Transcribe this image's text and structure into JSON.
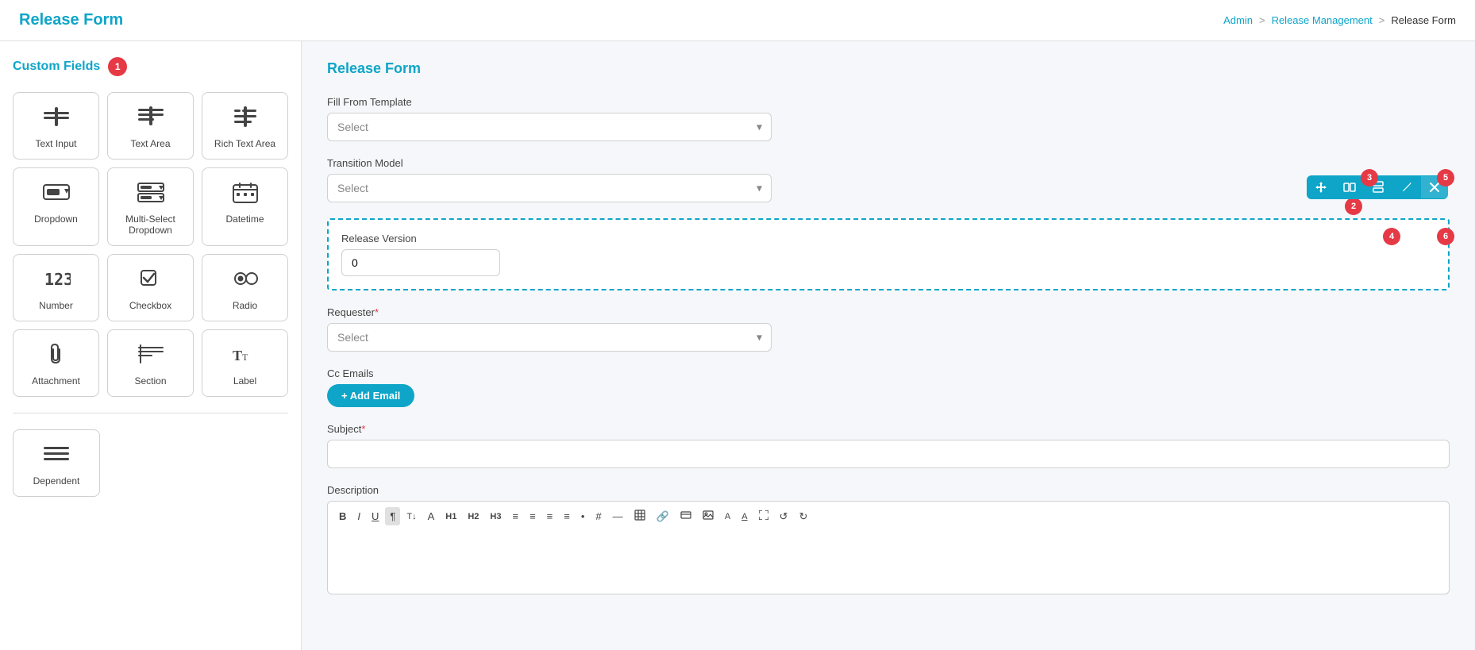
{
  "header": {
    "title": "Release Form",
    "breadcrumb": {
      "admin": "Admin",
      "separator1": ">",
      "release_management": "Release Management",
      "separator2": ">",
      "current": "Release Form"
    }
  },
  "sidebar": {
    "title": "Custom Fields",
    "badge": "1",
    "fields": [
      {
        "id": "text-input",
        "label": "Text Input",
        "icon": "text_input"
      },
      {
        "id": "text-area",
        "label": "Text Area",
        "icon": "text_area"
      },
      {
        "id": "rich-text-area",
        "label": "Rich Text Area",
        "icon": "rich_text"
      },
      {
        "id": "dropdown",
        "label": "Dropdown",
        "icon": "dropdown"
      },
      {
        "id": "multi-select-dropdown",
        "label": "Multi-Select Dropdown",
        "icon": "multi_select"
      },
      {
        "id": "datetime",
        "label": "Datetime",
        "icon": "datetime"
      },
      {
        "id": "number",
        "label": "Number",
        "icon": "number"
      },
      {
        "id": "checkbox",
        "label": "Checkbox",
        "icon": "checkbox"
      },
      {
        "id": "radio",
        "label": "Radio",
        "icon": "radio"
      },
      {
        "id": "attachment",
        "label": "Attachment",
        "icon": "attachment"
      },
      {
        "id": "section",
        "label": "Section",
        "icon": "section"
      },
      {
        "id": "label",
        "label": "Label",
        "icon": "label"
      },
      {
        "id": "dependent",
        "label": "Dependent",
        "icon": "dependent"
      }
    ]
  },
  "main": {
    "title": "Release Form",
    "fill_from_template": {
      "label": "Fill From Template",
      "placeholder": "Select"
    },
    "transition_model": {
      "label": "Transition Model",
      "placeholder": "Select"
    },
    "release_version": {
      "label": "Release Version",
      "value": "0"
    },
    "requester": {
      "label": "Requester",
      "required": true,
      "placeholder": "Select"
    },
    "cc_emails": {
      "label": "Cc Emails",
      "add_button": "+ Add Email"
    },
    "subject": {
      "label": "Subject",
      "required": true,
      "value": ""
    },
    "description": {
      "label": "Description",
      "toolbar_buttons": [
        "B",
        "I",
        "U",
        "¶",
        "T↓",
        "A",
        "H1",
        "H2",
        "H3",
        "≡",
        "≡",
        "≡",
        "≡",
        "•",
        "#",
        "—",
        "⊞",
        "🔗",
        "🖼",
        "📷",
        "A",
        "A",
        "⤢",
        "↺",
        "↻"
      ]
    }
  },
  "floating_toolbar": {
    "buttons": [
      "move",
      "split-col",
      "split-row",
      "edit",
      "close"
    ],
    "annotations": [
      "2",
      "3",
      "4",
      "5",
      "6"
    ]
  }
}
